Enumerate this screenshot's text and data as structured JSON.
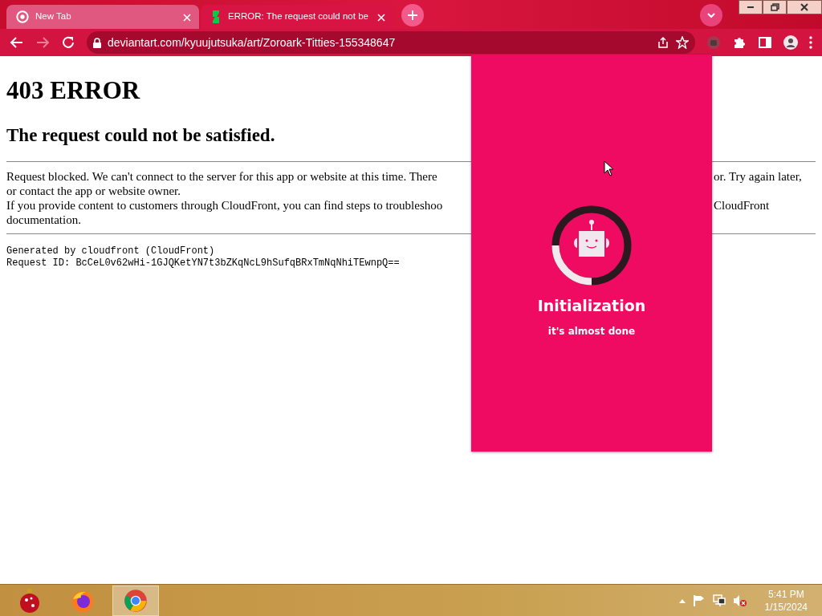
{
  "browser": {
    "tabs": [
      {
        "title": "New Tab",
        "selected": false
      },
      {
        "title": "ERROR: The request could not be",
        "selected": true
      }
    ],
    "address": "deviantart.com/kyuujutsuka/art/Zoroark-Titties-155348647"
  },
  "page": {
    "heading": "403 ERROR",
    "subheading": "The request could not be satisfied.",
    "lines": [
      {
        "left": "Request blocked. We can't connect to the server for this app or website at this time. There",
        "right": "or. Try again later,"
      },
      {
        "left": "or contact the app or website owner."
      },
      {
        "left": "If you provide content to customers through CloudFront, you can find steps to troubleshoo",
        "right": "CloudFront"
      },
      {
        "left": "documentation."
      }
    ],
    "generated": "Generated by cloudfront (CloudFront)",
    "request_id": "Request ID: BcCeL0v62wHi-1GJQKetYN7t3bZKqNcL9hSufqBRxTmNqNhiTEwnpQ=="
  },
  "popup": {
    "title": "Initialization",
    "subtitle": "it's almost done"
  },
  "taskbar": {
    "apps": [
      {
        "kind": "ornament",
        "selected": false
      },
      {
        "kind": "firefox",
        "selected": false
      },
      {
        "kind": "chrome",
        "selected": true
      }
    ],
    "time": "5:41 PM",
    "date": "1/15/2024"
  }
}
